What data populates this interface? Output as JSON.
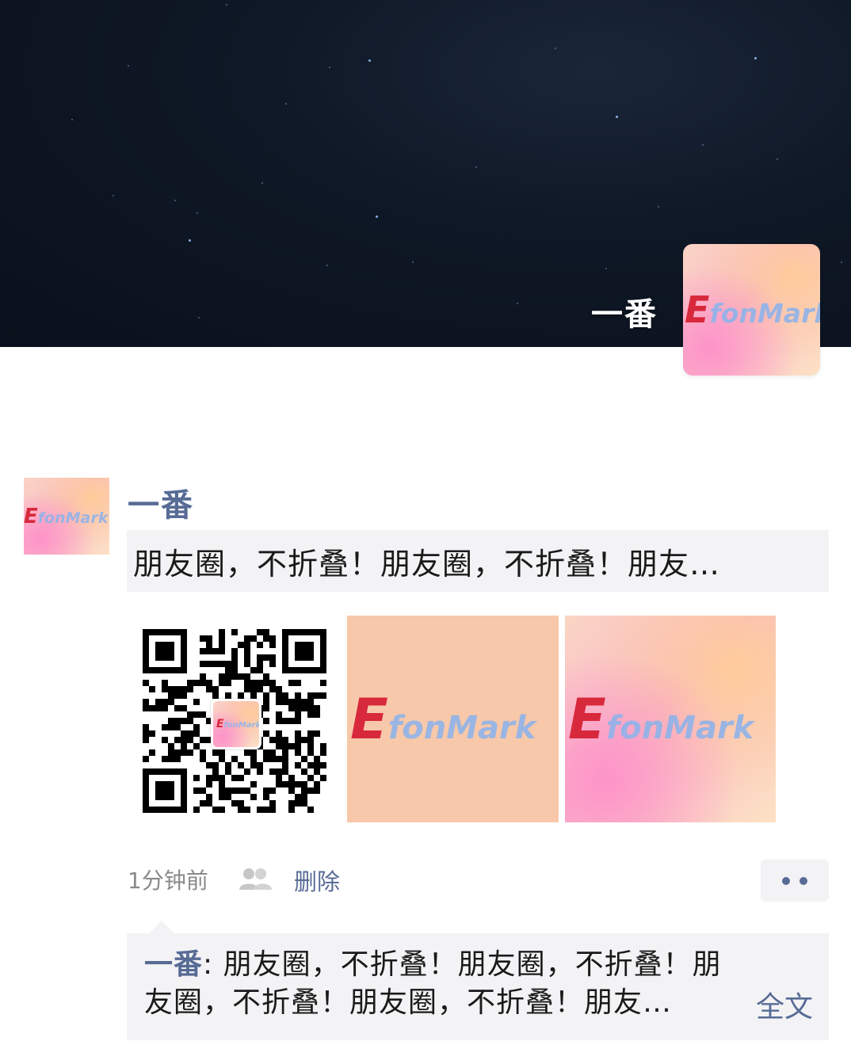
{
  "cover": {
    "user_name": "一番",
    "avatar_logo": {
      "e": "E",
      "rest": "fonMark"
    }
  },
  "post": {
    "author": "一番",
    "avatar_logo": {
      "e": "E",
      "rest": "fonMark"
    },
    "share_text": "朋友圈，不折叠！朋友圈，不折叠！朋友…",
    "images": [
      {
        "type": "qr-code",
        "logo": {
          "e": "E",
          "rest": "fonMark"
        }
      },
      {
        "type": "logo",
        "logo": {
          "e": "E",
          "rest": "fonMark"
        },
        "background": "#f7c8a9"
      },
      {
        "type": "logo",
        "logo": {
          "e": "E",
          "rest": "fonMark"
        }
      }
    ],
    "meta": {
      "time": "1分钟前",
      "visibility_icon": "friends-icon",
      "delete_label": "删除",
      "more_icon": "more-dots-icon"
    },
    "comment": {
      "author": "一番",
      "separator": ": ",
      "text": "朋友圈，不折叠！朋友圈，不折叠！朋友圈，不折叠！朋友圈，不折叠！朋友…",
      "full_text_label": "全文"
    }
  },
  "colors": {
    "link": "#576b95",
    "panel": "#f3f3f5",
    "logo_e": "#d8283c",
    "logo_rest": "#8fb3ea"
  }
}
